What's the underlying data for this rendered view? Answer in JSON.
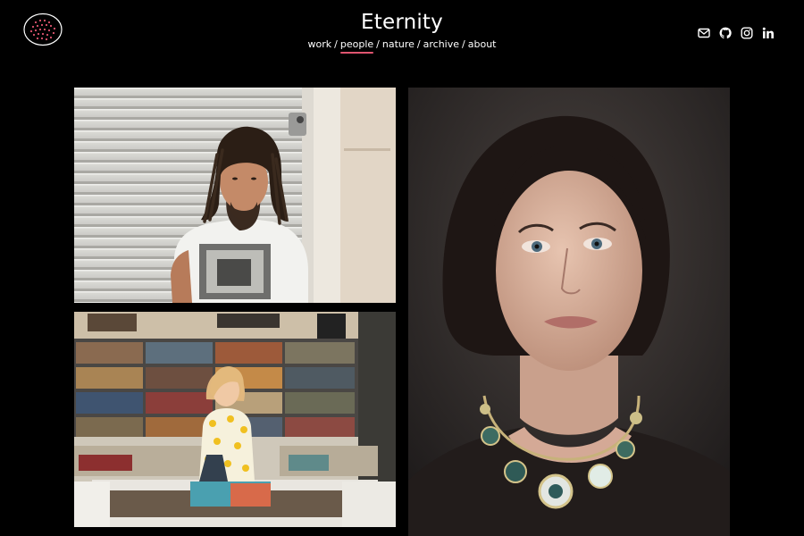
{
  "site": {
    "title": "Eternity",
    "logo_icon": "dotted-circle-logo-icon"
  },
  "nav": {
    "items": [
      {
        "label": "work",
        "active": false
      },
      {
        "label": "people",
        "active": true
      },
      {
        "label": "nature",
        "active": false
      },
      {
        "label": "archive",
        "active": false
      },
      {
        "label": "about",
        "active": false
      }
    ],
    "separator": "/",
    "active_underline_color": "#e0556f"
  },
  "social": [
    "mail-icon",
    "github-icon",
    "instagram-icon",
    "linkedin-icon"
  ],
  "gallery": {
    "photos": [
      {
        "subject": "man with dreadlocks leaning against garage door"
      },
      {
        "subject": "woman browsing records in a vinyl store"
      },
      {
        "subject": "portrait of woman with jeweled necklace"
      }
    ]
  }
}
